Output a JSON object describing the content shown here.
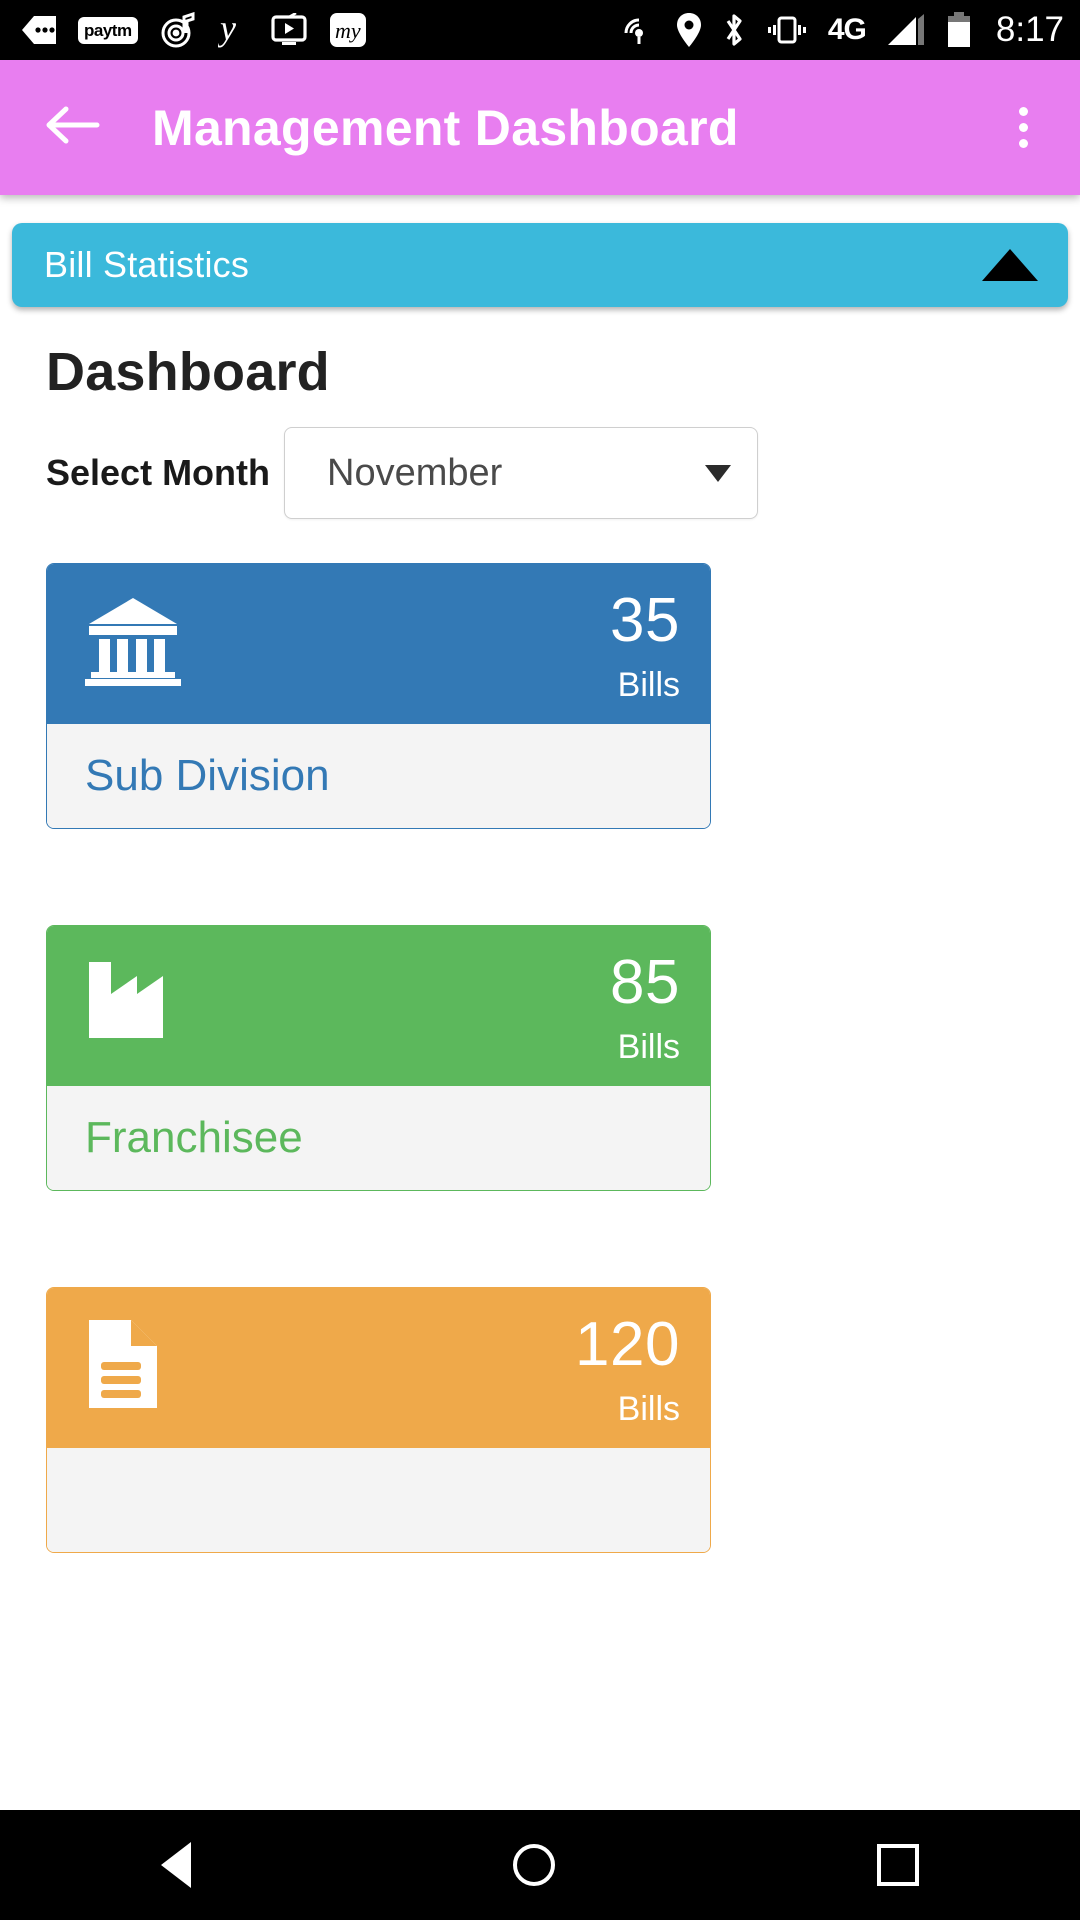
{
  "statusbar": {
    "time": "8:17",
    "network_type": "4G",
    "left_icons": [
      {
        "name": "more-dots-icon",
        "label": "•••"
      },
      {
        "name": "paytm-icon",
        "label": "paytm"
      },
      {
        "name": "music-target-icon",
        "label": "music"
      },
      {
        "name": "y-app-icon",
        "label": "y"
      },
      {
        "name": "tv-player-icon",
        "label": "tv"
      },
      {
        "name": "my-app-icon",
        "label": "my"
      }
    ],
    "right_icons": [
      {
        "name": "hotspot-icon"
      },
      {
        "name": "location-pin-icon"
      },
      {
        "name": "bluetooth-icon"
      },
      {
        "name": "vibrate-icon"
      },
      {
        "name": "signal-bars-icon"
      },
      {
        "name": "battery-icon"
      }
    ]
  },
  "appbar": {
    "title": "Management Dashboard",
    "back_icon": "back-arrow-icon",
    "overflow_icon": "overflow-menu-icon",
    "background": "#e87ef0"
  },
  "panel": {
    "title": "Bill Statistics",
    "collapse_icon": "triangle-up-icon",
    "background": "#3bb9db"
  },
  "dashboard": {
    "heading": "Dashboard",
    "month_label": "Select Month",
    "month_value": "November",
    "month_placeholder": "Select Month",
    "dropdown_icon": "triangle-down-icon"
  },
  "cards": [
    {
      "id": "sub-division",
      "count": "35",
      "unit": "Bills",
      "label": "Sub Division",
      "icon": "bank-building-icon",
      "color": "#3379b5"
    },
    {
      "id": "franchisee",
      "count": "85",
      "unit": "Bills",
      "label": "Franchisee",
      "icon": "factory-icon",
      "color": "#5cb85c"
    },
    {
      "id": "bills",
      "count": "120",
      "unit": "Bills",
      "label": "",
      "icon": "document-icon",
      "color": "#efa94a"
    }
  ],
  "navbar": {
    "back": "nav-back-icon",
    "home": "nav-home-icon",
    "recents": "nav-recents-icon"
  }
}
